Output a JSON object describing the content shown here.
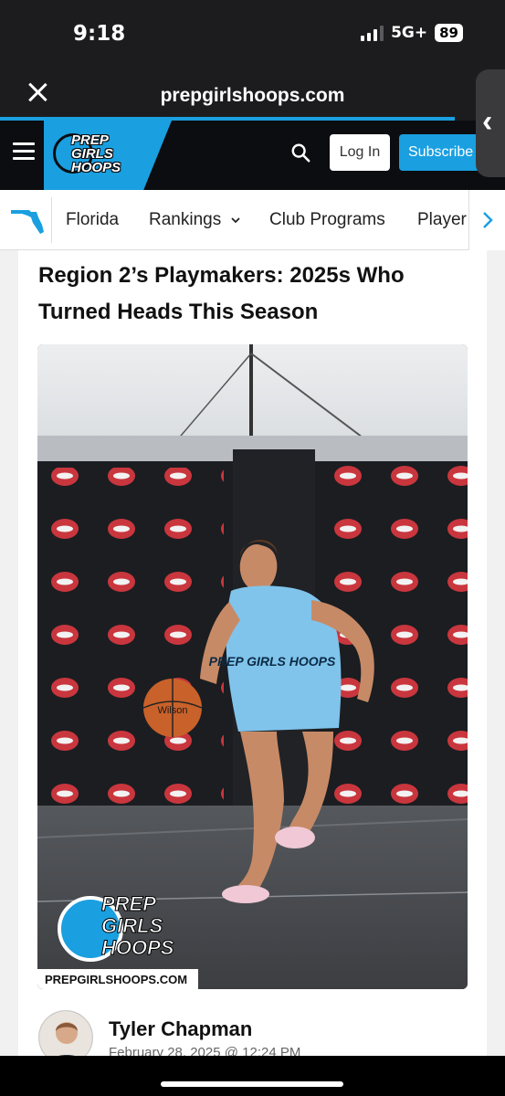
{
  "status_bar": {
    "time": "9:18",
    "network": "5G+",
    "battery": "89"
  },
  "browser": {
    "url": "prepgirlshoops.com",
    "close_icon": "close-icon",
    "load_progress": 0.9
  },
  "site_header": {
    "brand_line1": "PREP",
    "brand_line2": "GIRLS",
    "brand_line3": "HOOPS",
    "login_label": "Log In",
    "subscribe_label": "Subscribe",
    "accent_color": "#1a9fe0"
  },
  "state_nav": {
    "items": [
      {
        "label": "Florida"
      },
      {
        "label": "Rankings"
      },
      {
        "label": "Club Programs"
      },
      {
        "label": "Player"
      }
    ]
  },
  "article": {
    "headline": "Region 2’s Playmakers: 2025s Who Turned Heads This Season",
    "hero_watermark_line1": "PREP",
    "hero_watermark_line2": "GIRLS",
    "hero_watermark_line3": "HOOPS",
    "hero_watermark_url": "PREPGIRLSHOOPS.COM",
    "jersey_text": "PREP GIRLS HOOPS",
    "ball_text": "Wilson",
    "author_name": "Tyler Chapman",
    "date": "February 28, 2025 @ 12:24 PM"
  }
}
